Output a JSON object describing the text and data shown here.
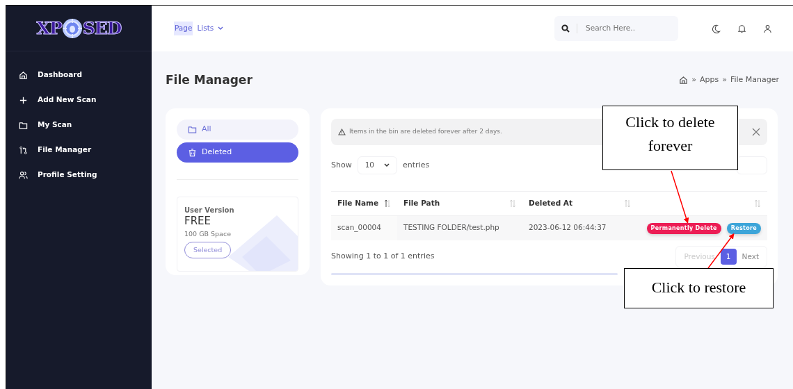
{
  "logo": {
    "left": "XP",
    "right": "SED"
  },
  "sidebar": {
    "items": [
      {
        "label": "Dashboard"
      },
      {
        "label": "Add New Scan"
      },
      {
        "label": "My Scan"
      },
      {
        "label": "File Manager"
      },
      {
        "label": "Profile Setting"
      }
    ]
  },
  "header": {
    "menu": {
      "highlighted": "Page",
      "rest": "Lists"
    },
    "search": {
      "placeholder": "Search Here.."
    }
  },
  "page_title": "File Manager",
  "breadcrumb": [
    {
      "separator": "»",
      "label": "Apps"
    },
    {
      "separator": "»",
      "label": "File Manager"
    }
  ],
  "folders": [
    {
      "label": "All",
      "selected": false
    },
    {
      "label": "Deleted",
      "selected": true
    }
  ],
  "plan": {
    "heading": "User Version",
    "name": "FREE",
    "space": "100 GB Space",
    "button": "Selected"
  },
  "alert": {
    "text": "Items in the bin are deleted forever after 2 days."
  },
  "length_menu": {
    "before": "Show",
    "value": "10",
    "after": "entries"
  },
  "table": {
    "columns": [
      {
        "label": "File Name",
        "sorted": true
      },
      {
        "label": "File Path",
        "sorted": false
      },
      {
        "label": "Deleted At",
        "sorted": false
      },
      {
        "sorted": false
      }
    ],
    "rows": [
      {
        "cells": [
          "scan_00004",
          "TESTING FOLDER/test.php",
          "2023-06-12 06:44:37"
        ],
        "actions": [
          {
            "kind": "danger",
            "label": "Permanently Delete"
          },
          {
            "kind": "info",
            "label": "Restore"
          }
        ]
      }
    ]
  },
  "info": "Showing 1 to 1 of 1 entries",
  "pagination": [
    {
      "label": "Previous",
      "selected": false,
      "disabled": true
    },
    {
      "label": "1",
      "selected": true,
      "disabled": false
    },
    {
      "label": "Next",
      "selected": false,
      "disabled": false
    }
  ],
  "annotations": [
    {
      "text": "Click to delete forever"
    },
    {
      "text": "Click to restore"
    }
  ]
}
